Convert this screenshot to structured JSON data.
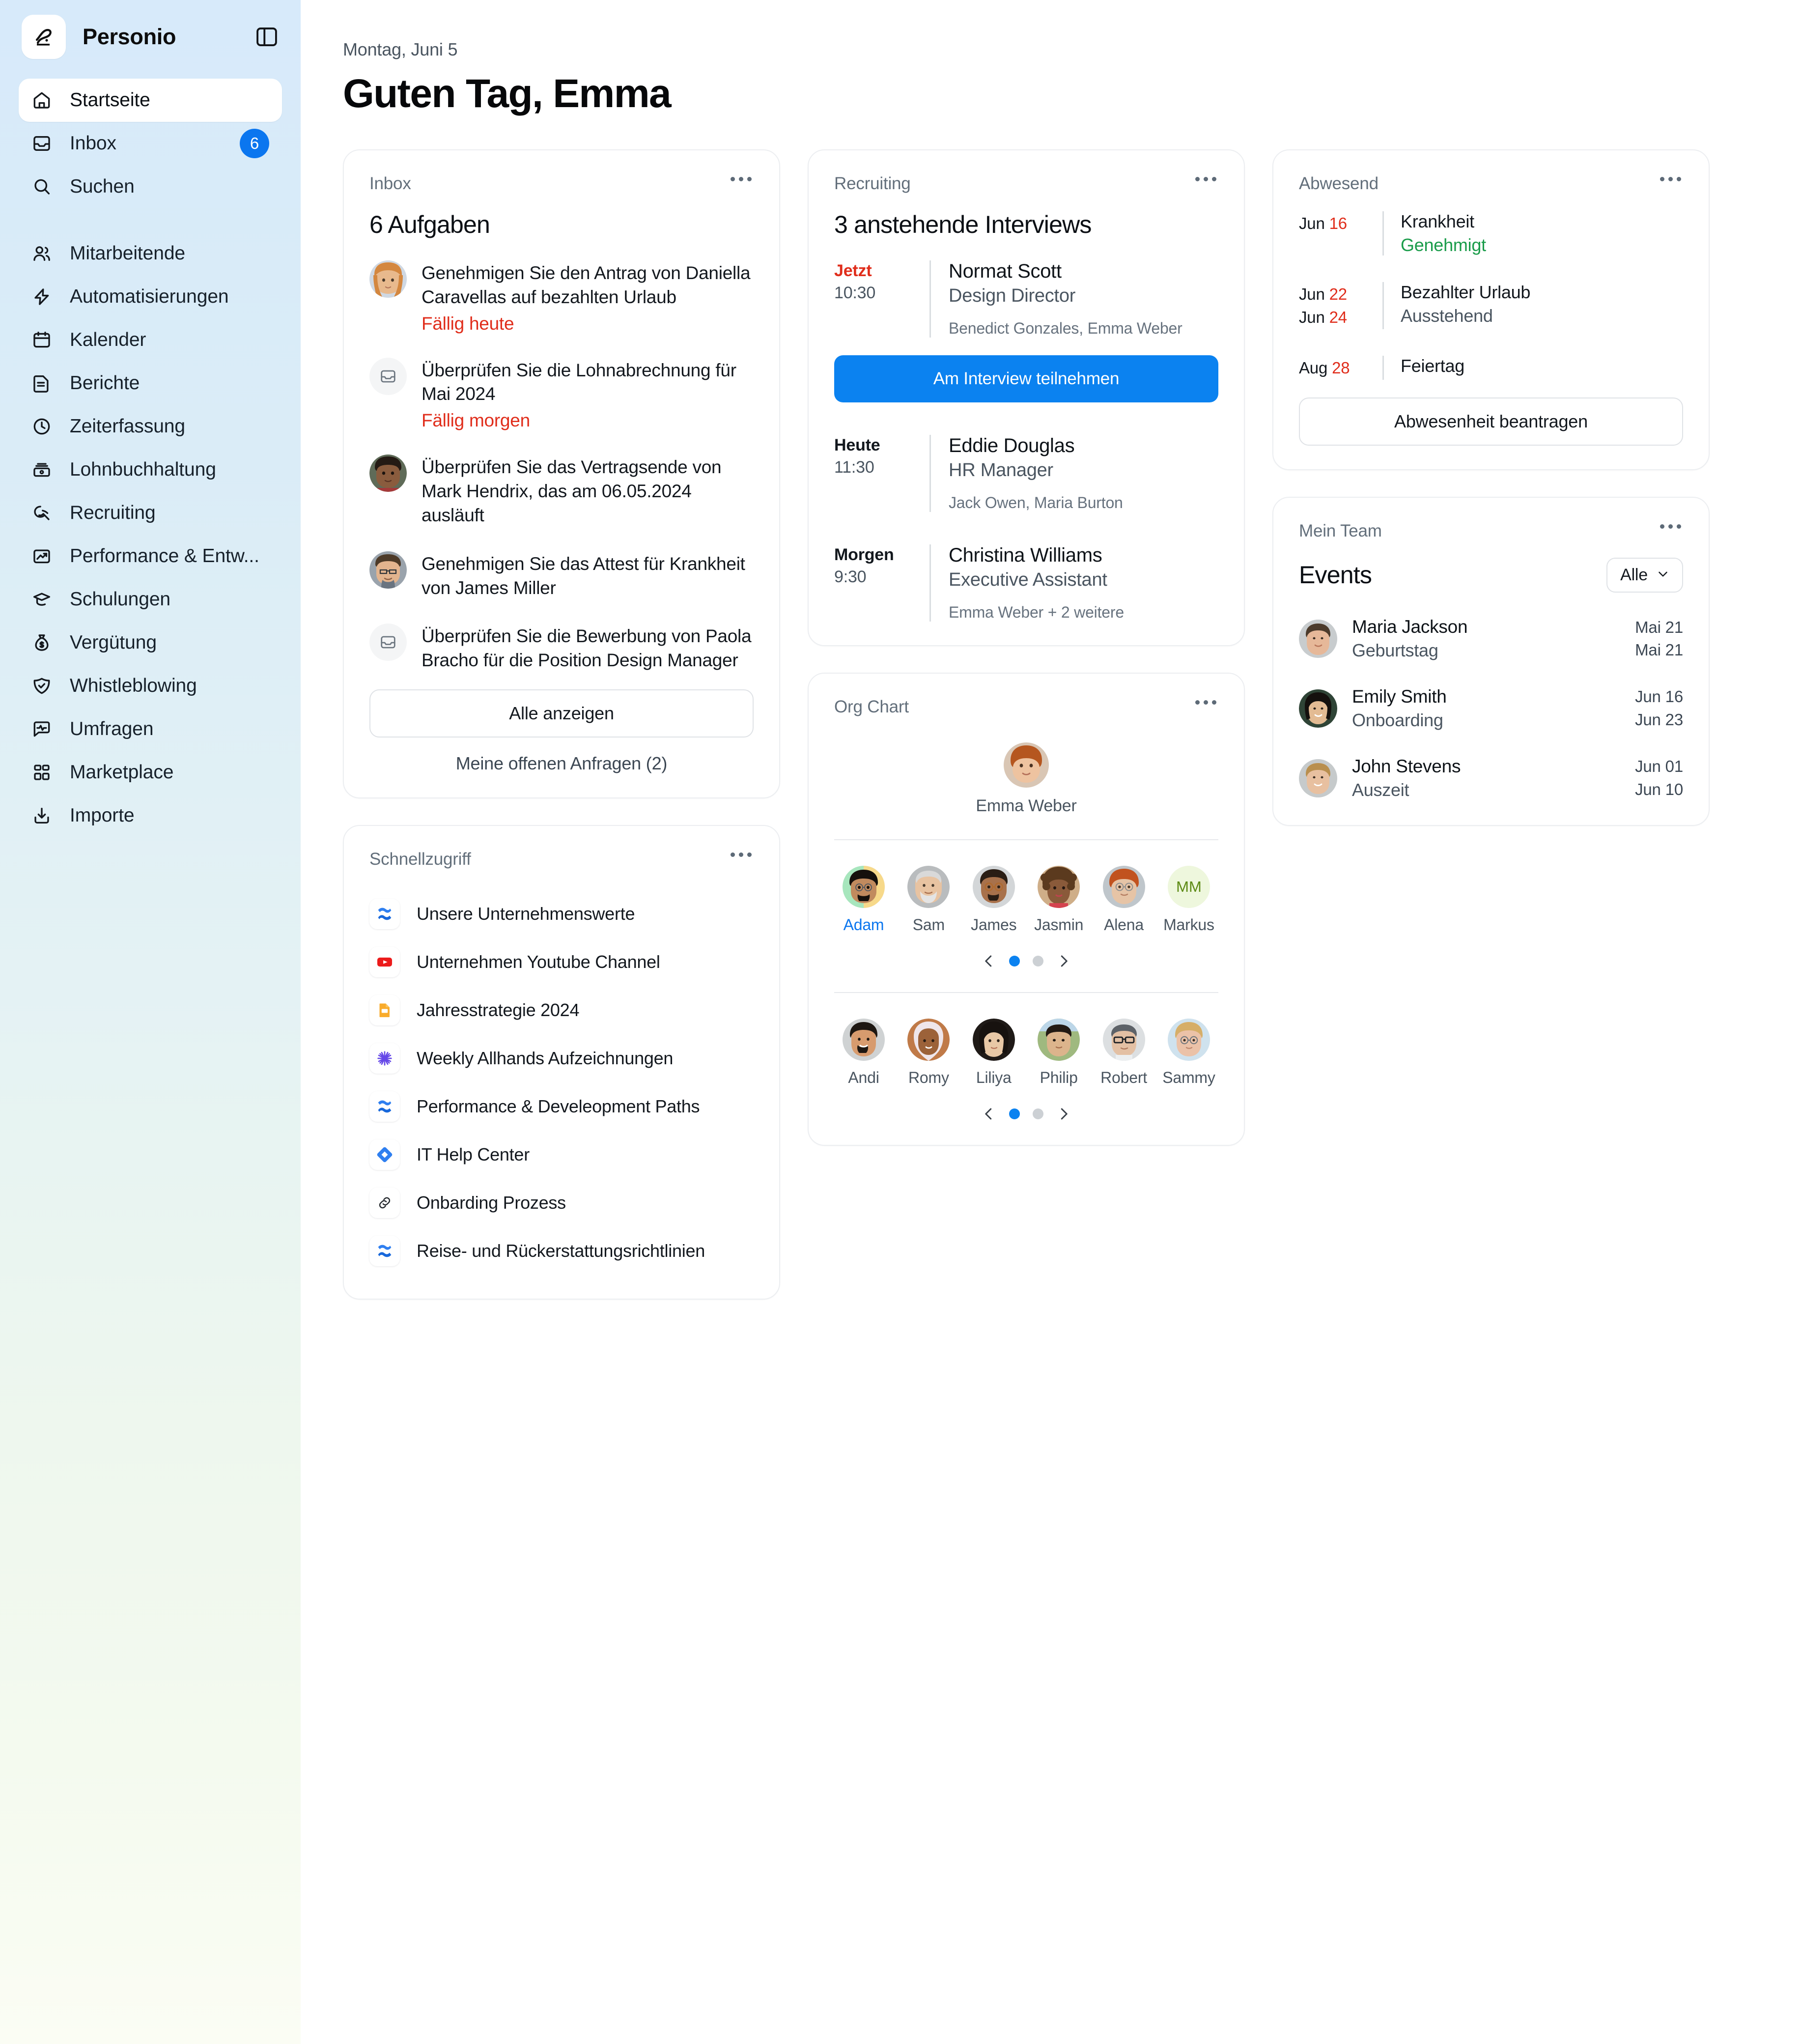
{
  "sidebar": {
    "brand": "Personio",
    "logo_icon": "personio-p-logo",
    "toggle_icon": "sidebar-toggle-icon",
    "top_items": [
      {
        "label": "Startseite",
        "icon": "home-icon",
        "active": true
      },
      {
        "label": "Inbox",
        "icon": "inbox-icon",
        "badge": "6"
      },
      {
        "label": "Suchen",
        "icon": "search-icon"
      }
    ],
    "items": [
      {
        "label": "Mitarbeitende",
        "icon": "people-icon"
      },
      {
        "label": "Automatisierungen",
        "icon": "lightning-icon"
      },
      {
        "label": "Kalender",
        "icon": "calendar-icon"
      },
      {
        "label": "Berichte",
        "icon": "document-icon"
      },
      {
        "label": "Zeiterfassung",
        "icon": "clock-icon"
      },
      {
        "label": "Lohnbuchhaltung",
        "icon": "cash-icon"
      },
      {
        "label": "Recruiting",
        "icon": "recruiting-icon"
      },
      {
        "label": "Performance & Entw...",
        "icon": "chart-up-icon"
      },
      {
        "label": "Schulungen",
        "icon": "graduation-cap-icon"
      },
      {
        "label": "Vergütung",
        "icon": "money-bag-icon"
      },
      {
        "label": "Whistleblowing",
        "icon": "shield-check-icon"
      },
      {
        "label": "Umfragen",
        "icon": "survey-chat-icon"
      },
      {
        "label": "Marketplace",
        "icon": "grid-blocks-icon"
      },
      {
        "label": "Importe",
        "icon": "import-download-icon"
      }
    ]
  },
  "header": {
    "date": "Montag, Juni 5",
    "greeting": "Guten Tag, Emma"
  },
  "inbox_card": {
    "kicker": "Inbox",
    "title": "6 Aufgaben",
    "tasks": [
      {
        "text": "Genehmigen Sie den Antrag von Daniella Caravellas auf bezahlten Urlaub",
        "due": "Fällig heute",
        "avatar": "woman-red-hair"
      },
      {
        "text": "Überprüfen Sie die Lohnabrechnung für Mai 2024",
        "due": "Fällig morgen",
        "avatar": "inbox-placeholder-icon"
      },
      {
        "text": "Überprüfen Sie das Vertragsende von Mark Hendrix, das am 06.05.2024 ausläuft",
        "due": "",
        "avatar": "young-man-curly"
      },
      {
        "text": "Genehmigen Sie das Attest für Krankheit von James Miller",
        "due": "",
        "avatar": "man-glasses-beard"
      },
      {
        "text": "Überprüfen Sie die Bewerbung von Paola Bracho für die Position Design Manager",
        "due": "",
        "avatar": "inbox-placeholder-icon"
      }
    ],
    "show_all_label": "Alle anzeigen",
    "my_requests_label": "Meine offenen Anfragen (2)"
  },
  "quick_access": {
    "kicker": "Schnellzugriff",
    "items": [
      {
        "label": "Unsere Unternehmenswerte",
        "icon": "confluence-icon"
      },
      {
        "label": "Unternehmen Youtube Channel",
        "icon": "youtube-icon"
      },
      {
        "label": "Jahresstrategie 2024",
        "icon": "google-slides-icon"
      },
      {
        "label": "Weekly Allhands Aufzeichnungen",
        "icon": "asterisk-purple-icon"
      },
      {
        "label": "Performance & Develeopment Paths",
        "icon": "confluence-icon"
      },
      {
        "label": "IT Help Center",
        "icon": "jira-service-icon"
      },
      {
        "label": "Onbarding Prozess",
        "icon": "link-chain-icon"
      },
      {
        "label": "Reise- und Rückerstattungsrichtlinien",
        "icon": "confluence-icon"
      }
    ]
  },
  "recruiting_card": {
    "kicker": "Recruiting",
    "title": "3 anstehende Interviews",
    "join_button": "Am Interview teilnehmen",
    "interviews": [
      {
        "when": "Jetzt",
        "now": true,
        "time": "10:30",
        "name": "Normat Scott",
        "role": "Design Director",
        "people": "Benedict Gonzales, Emma Weber"
      },
      {
        "when": "Heute",
        "now": false,
        "time": "11:30",
        "name": "Eddie Douglas",
        "role": "HR Manager",
        "people": "Jack Owen, Maria Burton"
      },
      {
        "when": "Morgen",
        "now": false,
        "time": "9:30",
        "name": "Christina Williams",
        "role": "Executive Assistant",
        "people": "Emma Weber + 2 weitere"
      }
    ]
  },
  "org_chart": {
    "kicker": "Org Chart",
    "root": {
      "name": "Emma Weber",
      "avatar": "woman-curly-red-hair"
    },
    "row1": [
      {
        "name": "Adam",
        "selected": true,
        "avatar": "man-beard-glasses"
      },
      {
        "name": "Sam",
        "selected": false,
        "avatar": "older-man-white-beard"
      },
      {
        "name": "James",
        "selected": false,
        "avatar": "man-round-glasses"
      },
      {
        "name": "Jasmin",
        "selected": false,
        "avatar": "woman-curly-hair"
      },
      {
        "name": "Alena",
        "selected": false,
        "avatar": "older-woman-red-hair"
      },
      {
        "name": "Markus",
        "selected": false,
        "initials": "MM"
      }
    ],
    "row2": [
      {
        "name": "Andi",
        "avatar": "man-smiling-beard"
      },
      {
        "name": "Romy",
        "avatar": "woman-headscarf"
      },
      {
        "name": "Liliya",
        "avatar": "woman-dark-hair"
      },
      {
        "name": "Philip",
        "avatar": "young-man-short-hair"
      },
      {
        "name": "Robert",
        "avatar": "man-black-glasses"
      },
      {
        "name": "Sammy",
        "avatar": "blond-man-glasses"
      }
    ],
    "carousel": {
      "prev_icon": "chevron-left-icon",
      "next_icon": "chevron-right-icon",
      "dots": 2,
      "active_dot": 0
    }
  },
  "absence_card": {
    "kicker": "Abwesend",
    "request_button": "Abwesenheit beantragen",
    "entries": [
      {
        "d1_month": "Jun",
        "d1_num": "16",
        "d2_month": "",
        "d2_num": "",
        "type": "Krankheit",
        "status": "Genehmigt",
        "status_ok": true
      },
      {
        "d1_month": "Jun",
        "d1_num": "22",
        "d2_month": "Jun",
        "d2_num": "24",
        "type": "Bezahlter Urlaub",
        "status": "Ausstehend",
        "status_ok": false
      },
      {
        "d1_month": "Aug",
        "d1_num": "28",
        "d2_month": "",
        "d2_num": "",
        "type": "Feiertag",
        "status": "",
        "status_ok": false
      }
    ]
  },
  "team_card": {
    "kicker": "Mein Team",
    "title": "Events",
    "filter_value": "Alle",
    "filter_icon": "chevron-down-icon",
    "events": [
      {
        "name": "Maria Jackson",
        "kind": "Geburtstag",
        "date1": "Mai 21",
        "date2": "Mai 21",
        "avatar": "woman-dark-hair-smiling"
      },
      {
        "name": "Emily Smith",
        "kind": "Onboarding",
        "date1": "Jun 16",
        "date2": "Jun 23",
        "avatar": "woman-long-black-hair"
      },
      {
        "name": "John Stevens",
        "kind": "Auszeit",
        "date1": "Jun 01",
        "date2": "Jun 10",
        "avatar": "man-blond-smiling"
      }
    ]
  },
  "colors": {
    "accent_blue": "#0b82f0",
    "badge_blue": "#0b76ef",
    "danger_red": "#e02d1b",
    "success_green": "#1a9c4a",
    "card_border": "#eceef1"
  }
}
